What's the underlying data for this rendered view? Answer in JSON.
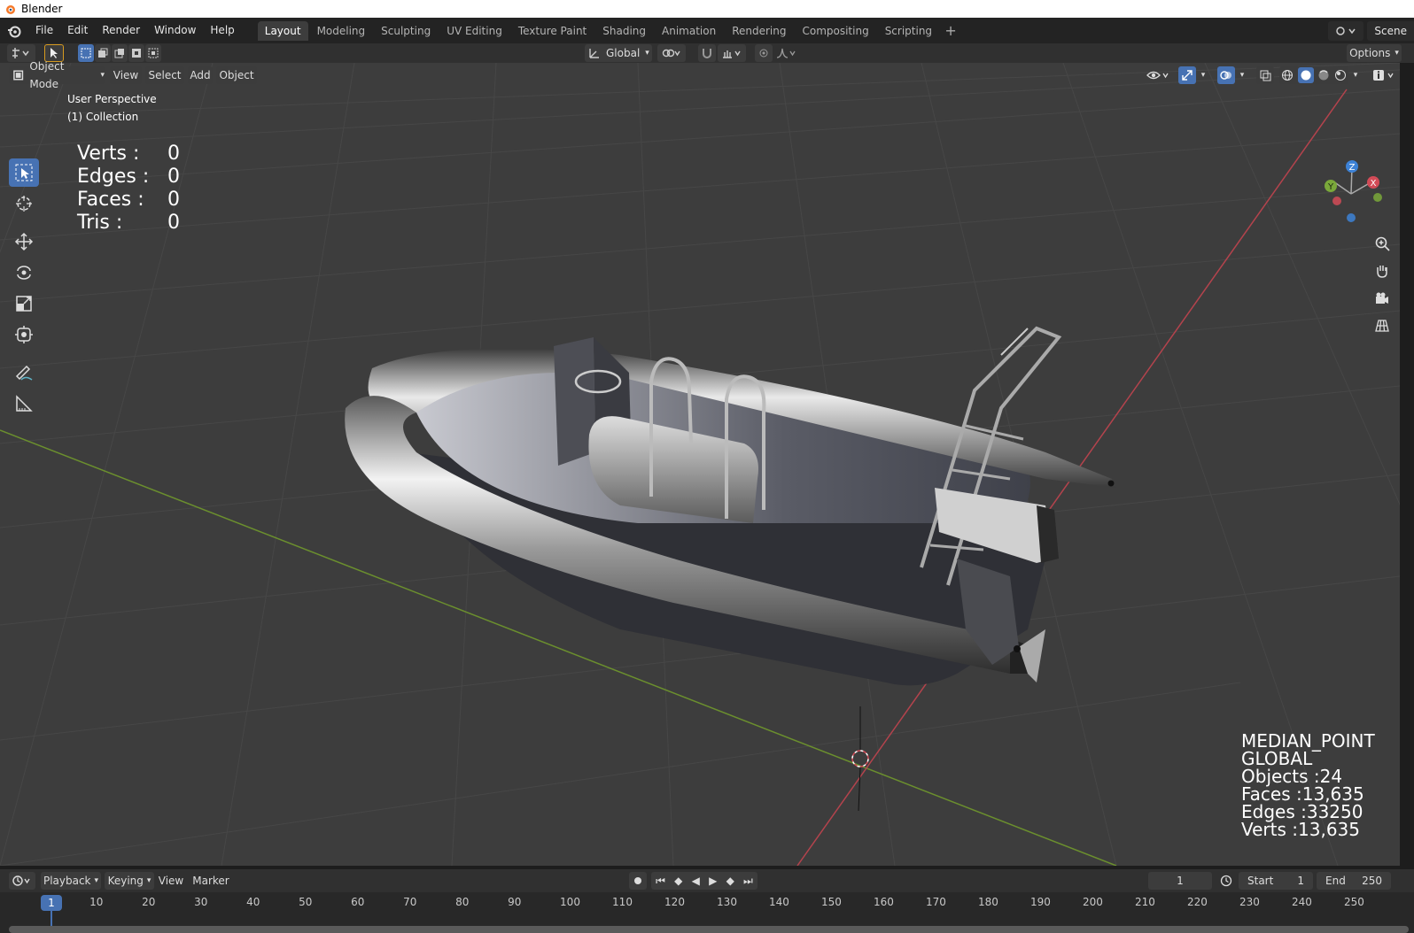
{
  "window": {
    "title": "Blender"
  },
  "menus": [
    "File",
    "Edit",
    "Render",
    "Window",
    "Help"
  ],
  "workspaces": [
    {
      "label": "Layout",
      "active": true
    },
    {
      "label": "Modeling"
    },
    {
      "label": "Sculpting"
    },
    {
      "label": "UV Editing"
    },
    {
      "label": "Texture Paint"
    },
    {
      "label": "Shading"
    },
    {
      "label": "Animation"
    },
    {
      "label": "Rendering"
    },
    {
      "label": "Compositing"
    },
    {
      "label": "Scripting"
    }
  ],
  "scene": {
    "label": "Scene"
  },
  "toolheader": {
    "orientation": "Global",
    "options": "Options"
  },
  "vpheader": {
    "mode": "Object Mode",
    "view": "View",
    "select": "Select",
    "add": "Add",
    "object": "Object"
  },
  "viewport": {
    "perspective": "User Perspective",
    "collection": "(1) Collection",
    "stats_left": [
      {
        "label": "Verts :",
        "value": "0"
      },
      {
        "label": "Edges :",
        "value": "0"
      },
      {
        "label": "Faces :",
        "value": "0"
      },
      {
        "label": "Tris :",
        "value": "0"
      }
    ],
    "stats_right": [
      "MEDIAN_POINT",
      "GLOBAL",
      "Objects :24",
      "Faces :13,635",
      "Edges :33250",
      "Verts :13,635"
    ],
    "gizmo_axes": [
      "Z",
      "Y",
      "X"
    ]
  },
  "timeline": {
    "playback": "Playback",
    "keying": "Keying",
    "view": "View",
    "marker": "Marker",
    "current_frame": "1",
    "start_label": "Start",
    "start_value": "1",
    "end_label": "End",
    "end_value": "250",
    "ticks": [
      "1",
      "10",
      "20",
      "30",
      "40",
      "50",
      "60",
      "70",
      "80",
      "90",
      "100",
      "110",
      "120",
      "130",
      "140",
      "150",
      "160",
      "170",
      "180",
      "190",
      "200",
      "210",
      "220",
      "230",
      "240",
      "250"
    ]
  },
  "colors": {
    "accent": "#4772b3",
    "x_axis": "#d24b57",
    "y_axis": "#7aa83a",
    "z_axis": "#3d82d6"
  }
}
